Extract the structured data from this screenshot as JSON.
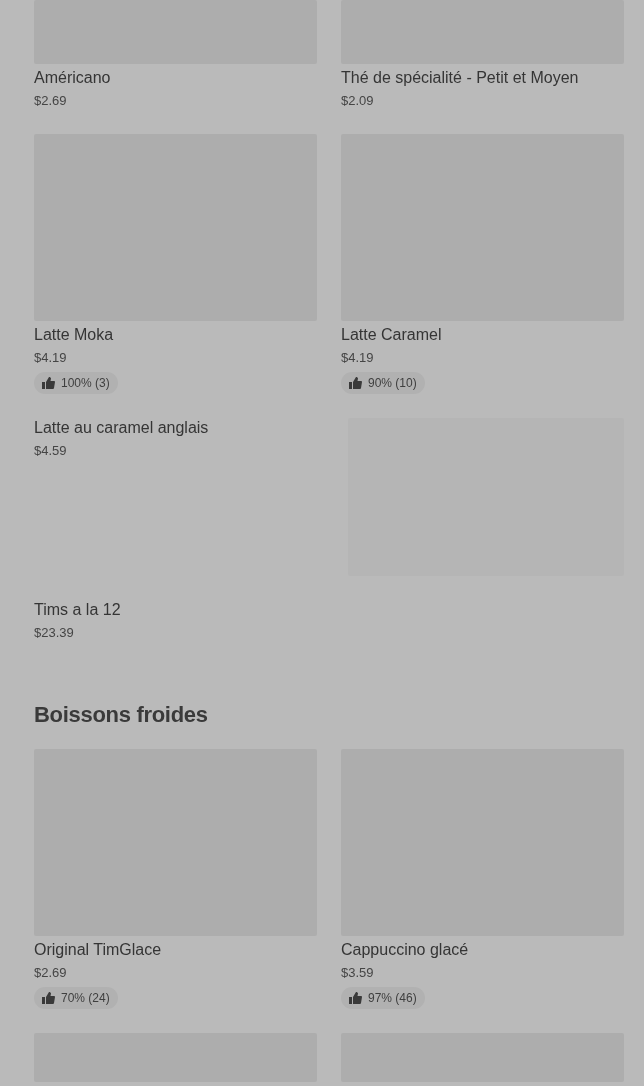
{
  "sections": [
    {
      "items": [
        {
          "kind": "product",
          "name": "Américano",
          "price": "$2.69"
        },
        {
          "kind": "product",
          "name": "Thé de spécialité - Petit et Moyen",
          "price": "$2.09"
        },
        {
          "kind": "product",
          "name": "Latte Moka",
          "price": "$4.19",
          "rating": "100% (3)"
        },
        {
          "kind": "product",
          "name": "Latte Caramel",
          "price": "$4.19",
          "rating": "90% (10)"
        },
        {
          "kind": "text",
          "name": "Latte au caramel anglais",
          "price": "$4.59"
        },
        {
          "kind": "blank"
        },
        {
          "kind": "text",
          "name": "Tims a la 12",
          "price": "$23.39"
        }
      ]
    },
    {
      "title": "Boissons froides",
      "items": [
        {
          "kind": "product",
          "name": "Original TimGlace",
          "price": "$2.69",
          "rating": "70% (24)"
        },
        {
          "kind": "product",
          "name": "Cappuccino glacé",
          "price": "$3.59",
          "rating": "97% (46)"
        },
        {
          "kind": "image"
        },
        {
          "kind": "image"
        }
      ]
    }
  ]
}
